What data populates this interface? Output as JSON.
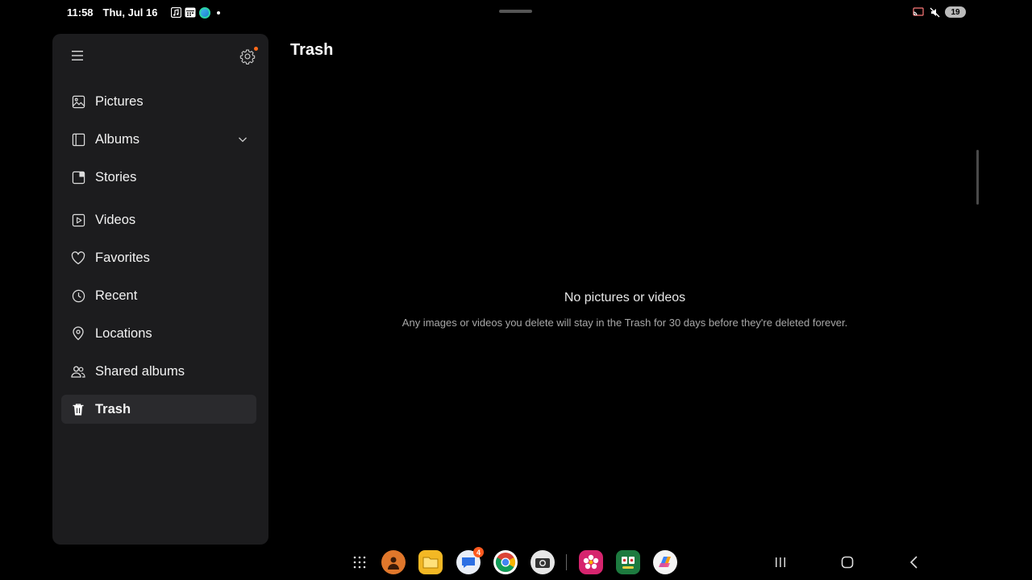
{
  "status": {
    "time": "11:58",
    "date": "Thu, Jul 16",
    "battery": "19"
  },
  "sidebar": {
    "items": [
      {
        "label": "Pictures",
        "icon": "image-icon"
      },
      {
        "label": "Albums",
        "icon": "album-icon"
      },
      {
        "label": "Stories",
        "icon": "stories-icon"
      },
      {
        "label": "Videos",
        "icon": "video-icon"
      },
      {
        "label": "Favorites",
        "icon": "heart-icon"
      },
      {
        "label": "Recent",
        "icon": "clock-icon"
      },
      {
        "label": "Locations",
        "icon": "location-pin-icon"
      },
      {
        "label": "Shared albums",
        "icon": "people-icon"
      },
      {
        "label": "Trash",
        "icon": "trash-icon",
        "active": true
      }
    ]
  },
  "main": {
    "title": "Trash",
    "empty_title": "No pictures or videos",
    "empty_description": "Any images or videos you delete will stay in the Trash for 30 days before they're deleted forever."
  },
  "taskbar": {
    "messages_badge": "4",
    "apps": [
      "contacts-app-icon",
      "files-app-icon",
      "messages-app-icon",
      "chrome-app-icon",
      "camera-app-icon",
      "gallery-app-icon",
      "game-app-icon",
      "copilot-app-icon"
    ]
  },
  "colors": {
    "background": "#000000",
    "sidebar": "#1c1c1e",
    "active_item": "#2a2a2d",
    "accent_badge": "#ff6a1a"
  }
}
